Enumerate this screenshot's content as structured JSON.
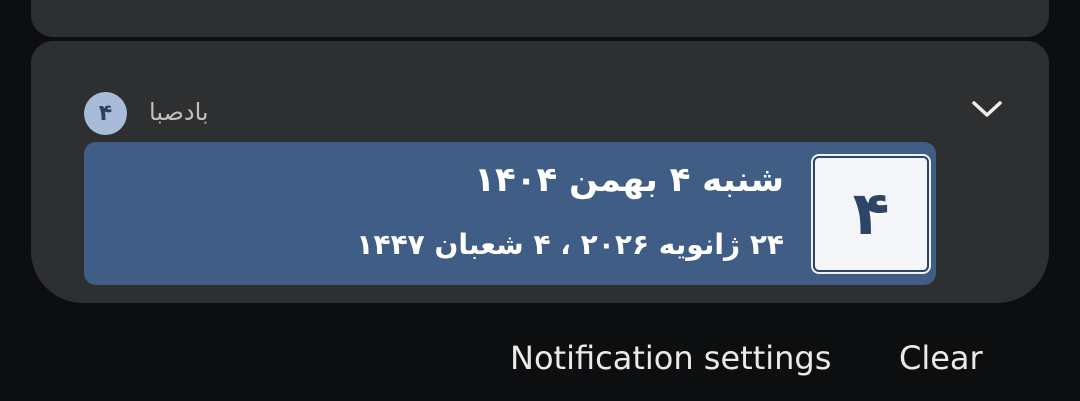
{
  "notification": {
    "app_badge": "۴",
    "app_name": "بادصبا",
    "day_number": "۴",
    "title": "شنبه ۴ بهمن ۱۴۰۴",
    "subtitle": "۲۴ ژانویه ۲۰۲۶ ، ۴ شعبان ۱۴۴۷",
    "expand_icon": "chevron-down-icon"
  },
  "actions": {
    "settings_label": "Notification settings",
    "clear_label": "Clear"
  },
  "colors": {
    "panel_background": "#2e2f31",
    "content_background": "#405d85",
    "badge_background": "#a8bcd9"
  }
}
